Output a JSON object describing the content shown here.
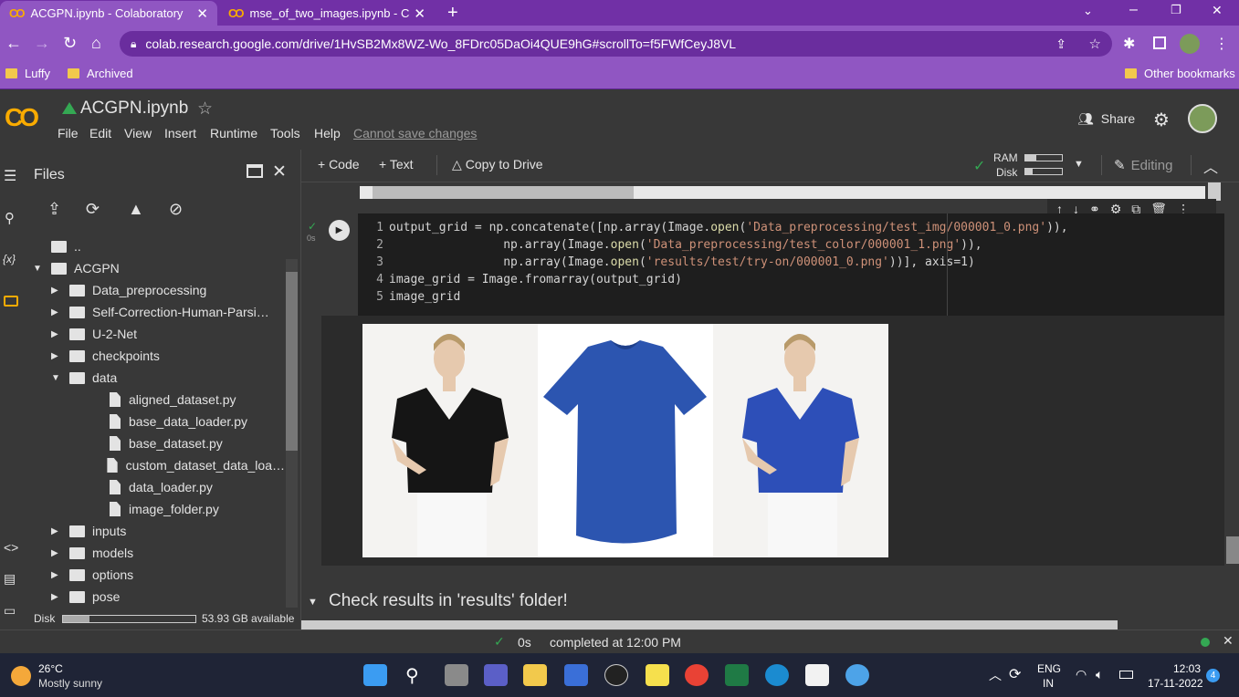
{
  "browser": {
    "tabs": [
      {
        "title": "ACGPN.ipynb - Colaboratory"
      },
      {
        "title": "mse_of_two_images.ipynb - Cola"
      }
    ],
    "url": "colab.research.google.com/drive/1HvSB2Mx8WZ-Wo_8FDrc05DaOi4QUE9hG#scrollTo=f5FWfCeyJ8VL",
    "bookmarks": [
      "Luffy",
      "Archived"
    ],
    "other_bookmarks": "Other bookmarks"
  },
  "colab": {
    "logo": "CO",
    "notebook_title": "ACGPN.ipynb",
    "menu": [
      "File",
      "Edit",
      "View",
      "Insert",
      "Runtime",
      "Tools",
      "Help"
    ],
    "cannot_save": "Cannot save changes",
    "share": "Share",
    "toolbar": {
      "code": "+ Code",
      "text": "+ Text",
      "copy_to_drive": "Copy to Drive",
      "ram": "RAM",
      "disk": "Disk",
      "editing": "Editing"
    }
  },
  "sidebar": {
    "title": "Files",
    "tree": [
      {
        "name": "..",
        "type": "up",
        "level": 0
      },
      {
        "name": "ACGPN",
        "type": "folder",
        "level": 0,
        "open": true
      },
      {
        "name": "Data_preprocessing",
        "type": "folder",
        "level": 1
      },
      {
        "name": "Self-Correction-Human-Parsi…",
        "type": "folder",
        "level": 1
      },
      {
        "name": "U-2-Net",
        "type": "folder",
        "level": 1
      },
      {
        "name": "checkpoints",
        "type": "folder",
        "level": 1
      },
      {
        "name": "data",
        "type": "folder",
        "level": 1,
        "open": true
      },
      {
        "name": "aligned_dataset.py",
        "type": "file",
        "level": 2
      },
      {
        "name": "base_data_loader.py",
        "type": "file",
        "level": 2
      },
      {
        "name": "base_dataset.py",
        "type": "file",
        "level": 2
      },
      {
        "name": "custom_dataset_data_loa…",
        "type": "file",
        "level": 2
      },
      {
        "name": "data_loader.py",
        "type": "file",
        "level": 2
      },
      {
        "name": "image_folder.py",
        "type": "file",
        "level": 2
      },
      {
        "name": "inputs",
        "type": "folder",
        "level": 1
      },
      {
        "name": "models",
        "type": "folder",
        "level": 1
      },
      {
        "name": "options",
        "type": "folder",
        "level": 1
      },
      {
        "name": "pose",
        "type": "folder",
        "level": 1
      }
    ],
    "disk_label": "Disk",
    "disk_available": "53.93 GB available",
    "disk_used_fraction": 0.2
  },
  "cell": {
    "exec_time": "0s",
    "code_lines": [
      {
        "n": "1",
        "pre": "output_grid = np.concatenate([np.array(Image.",
        "fn": "open",
        "str": "'Data_preprocessing/test_img/000001_0.png'",
        "post": ")),"
      },
      {
        "n": "2",
        "pre": "                np.array(Image.",
        "fn": "open",
        "str": "'Data_preprocessing/test_color/000001_1.png'",
        "post": ")),"
      },
      {
        "n": "3",
        "pre": "                np.array(Image.",
        "fn": "open",
        "str": "'results/test/try-on/000001_0.png'",
        "post": "))], axis=1)"
      },
      {
        "n": "4",
        "pre": "image_grid = Image.fromarray(output_grid)",
        "fn": "",
        "str": "",
        "post": ""
      },
      {
        "n": "5",
        "pre": "image_grid",
        "fn": "",
        "str": "",
        "post": ""
      }
    ]
  },
  "section_heading": "Check results in 'results' folder!",
  "status": {
    "time": "0s",
    "message": "completed at 12:00 PM"
  },
  "taskbar": {
    "weather_temp": "26°C",
    "weather_desc": "Mostly sunny",
    "lang1": "ENG",
    "lang2": "IN",
    "time": "12:03",
    "date": "17-11-2022",
    "notifications": "4"
  }
}
